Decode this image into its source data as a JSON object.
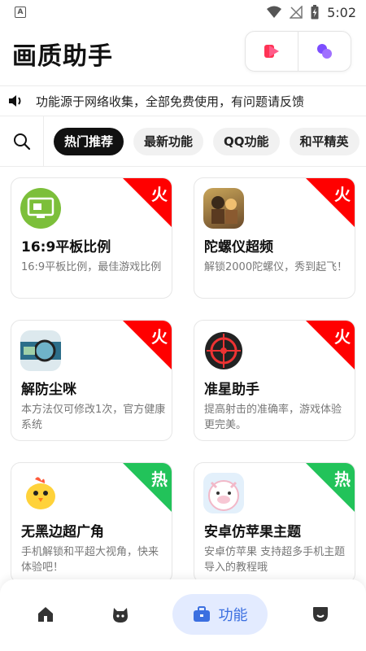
{
  "status_bar": {
    "time": "5:02",
    "left_glyph": "A"
  },
  "header": {
    "title": "画质助手",
    "buttons": [
      {
        "icon": "video-play-icon"
      },
      {
        "icon": "purple-dots-icon"
      }
    ]
  },
  "notice": {
    "icon": "speaker-icon",
    "text": "功能源于网络收集，全部免费使用，有问题请反馈"
  },
  "tabs": [
    {
      "label": "热门推荐",
      "active": true
    },
    {
      "label": "最新功能",
      "active": false
    },
    {
      "label": "QQ功能",
      "active": false
    },
    {
      "label": "和平精英",
      "active": false
    }
  ],
  "cards": [
    {
      "title": "16:9平板比例",
      "desc": "16:9平板比例，最佳游戏比例",
      "badge": "火",
      "badge_color": "#ff0000",
      "icon": "tablet-screen-icon"
    },
    {
      "title": "陀螺仪超频",
      "desc": "解锁2000陀螺仪，秀到起飞！",
      "badge": "火",
      "badge_color": "#ff0000",
      "icon": "game-characters-icon"
    },
    {
      "title": "解防尘咪",
      "desc": "本方法仅可修改1次，官方健康系统",
      "badge": "火",
      "badge_color": "#ff0000",
      "icon": "magnifier-screen-icon"
    },
    {
      "title": "准星助手",
      "desc": "提高射击的准确率，游戏体验更完美。",
      "badge": "火",
      "badge_color": "#ff0000",
      "icon": "crosshair-icon"
    },
    {
      "title": "无黑边超广角",
      "desc": "手机解锁和平超大视角，快来体验吧！",
      "badge": "热",
      "badge_color": "#22c35a",
      "icon": "chick-icon"
    },
    {
      "title": "安卓仿苹果主题",
      "desc": "安卓仿苹果 支持超多手机主题导入的教程哦",
      "badge": "热",
      "badge_color": "#22c35a",
      "icon": "pig-avatar-icon"
    }
  ],
  "bottom_nav": [
    {
      "icon": "home-icon",
      "label": "",
      "active": false
    },
    {
      "icon": "pet-face-icon",
      "label": "",
      "active": false
    },
    {
      "icon": "briefcase-icon",
      "label": "功能",
      "active": true
    },
    {
      "icon": "profile-icon",
      "label": "",
      "active": false
    }
  ]
}
